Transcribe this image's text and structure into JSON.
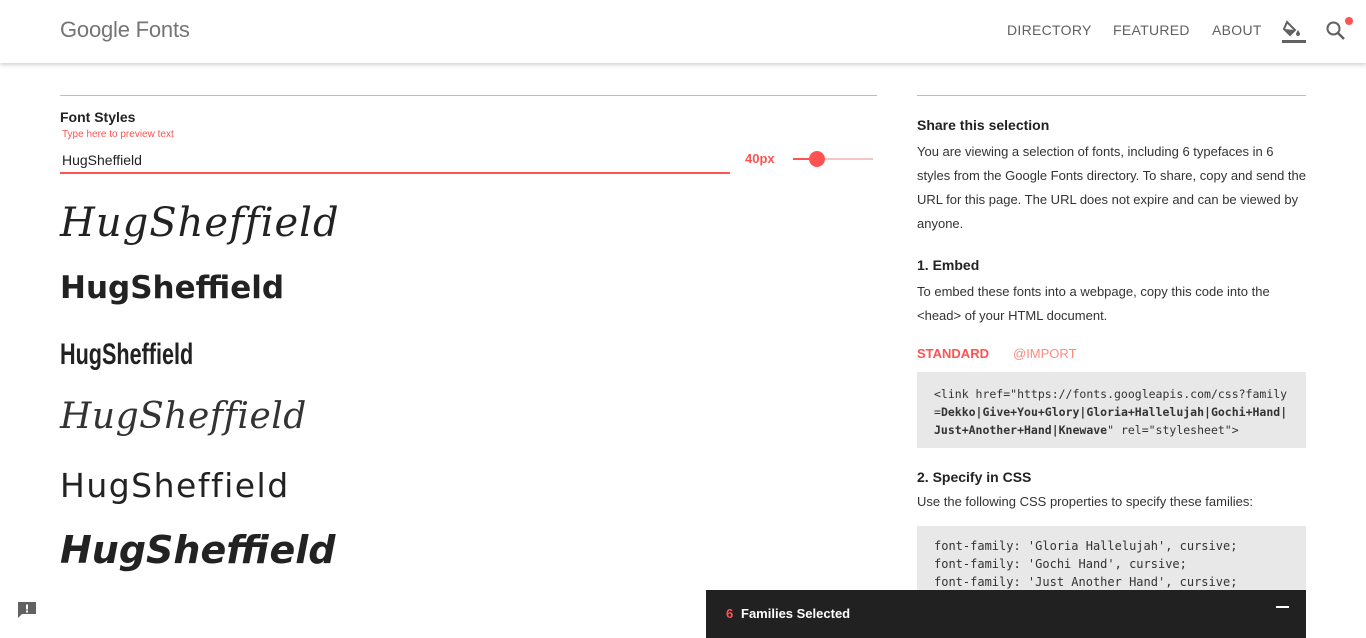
{
  "header": {
    "logo": "Google Fonts",
    "nav": [
      "DIRECTORY",
      "FEATURED",
      "ABOUT"
    ],
    "icons": [
      "paint-bucket-icon",
      "search-icon"
    ]
  },
  "font_styles": {
    "title": "Font Styles",
    "hint": "Type here to preview text",
    "input_value": "HugSheffield",
    "size": "40px",
    "size_slider_fraction": 0.3,
    "previews": [
      "HugSheffield",
      "HugSheffield",
      "HugSheffield",
      "HugSheffield",
      "HugSheffield",
      "HugSheffield"
    ]
  },
  "share": {
    "title": "Share this selection",
    "body": "You are viewing a selection of fonts, including 6 typefaces in 6 styles from the Google Fonts directory. To share, copy and send the URL for this page. The URL does not expire and can be viewed by anyone."
  },
  "embed": {
    "title": "1. Embed",
    "body": "To embed these fonts into a webpage, copy this code into the <head> of your HTML document.",
    "tabs": [
      "STANDARD",
      "@IMPORT"
    ],
    "code_prefix": "<link href=\"https://fonts.googleapis.com/css?family=",
    "code_families": "Dekko|Give+You+Glory|Gloria+Hallelujah|Gochi+Hand|Just+Another+Hand|Knewave",
    "code_suffix": "\" rel=\"stylesheet\">"
  },
  "css": {
    "title": "2. Specify in CSS",
    "body": "Use the following CSS properties to specify these families:",
    "lines": [
      "font-family: 'Gloria Hallelujah', cursive;",
      "font-family: 'Gochi Hand', cursive;",
      "font-family: 'Just Another Hand', cursive;"
    ]
  },
  "tray": {
    "count": "6",
    "label": "Families Selected"
  },
  "colors": {
    "accent": "#ff5252",
    "tray_bg": "#212121",
    "code_bg": "#e8e8e8"
  }
}
